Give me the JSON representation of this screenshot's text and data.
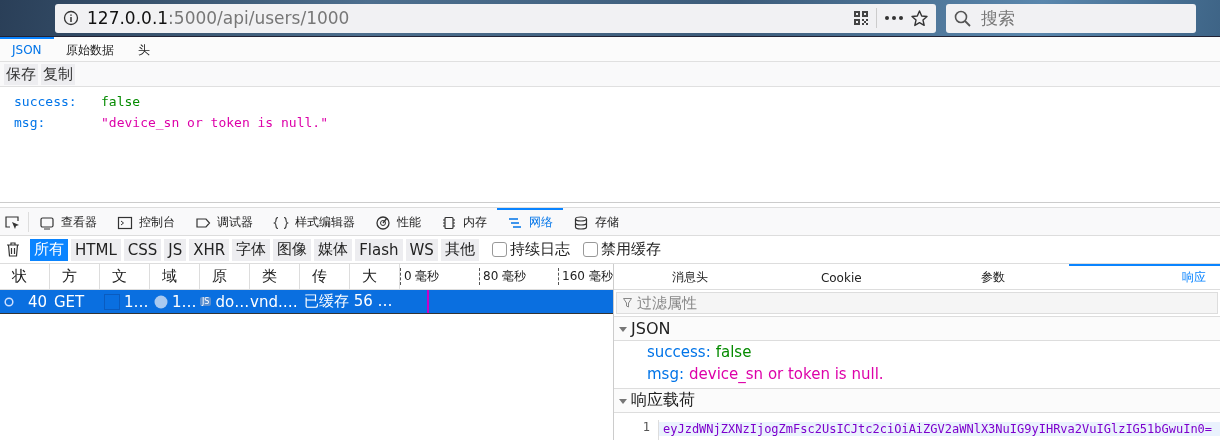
{
  "browser": {
    "url_host": "127.0.0.1",
    "url_path": ":5000/api/users/1000",
    "search_placeholder": "搜索"
  },
  "viewer_tabs": [
    {
      "label": "JSON",
      "selected": true
    },
    {
      "label": "原始数据",
      "selected": false
    },
    {
      "label": "头",
      "selected": false
    }
  ],
  "viewer_buttons": [
    "保存",
    "复制"
  ],
  "json_rows": [
    {
      "key": "success:",
      "value": "false",
      "kind": "boolean"
    },
    {
      "key": "msg:",
      "value": "\"device_sn or token is null.\"",
      "kind": "string"
    }
  ],
  "devtools_tabs": [
    {
      "label": "查看器",
      "selected": false
    },
    {
      "label": "控制台",
      "selected": false
    },
    {
      "label": "调试器",
      "selected": false
    },
    {
      "label": "样式编辑器",
      "selected": false
    },
    {
      "label": "性能",
      "selected": false
    },
    {
      "label": "内存",
      "selected": false
    },
    {
      "label": "网络",
      "selected": true
    },
    {
      "label": "存储",
      "selected": false
    }
  ],
  "filters": [
    {
      "label": "所有",
      "selected": true
    },
    {
      "label": "HTML",
      "selected": false
    },
    {
      "label": "CSS",
      "selected": false
    },
    {
      "label": "JS",
      "selected": false
    },
    {
      "label": "XHR",
      "selected": false
    },
    {
      "label": "字体",
      "selected": false
    },
    {
      "label": "图像",
      "selected": false
    },
    {
      "label": "媒体",
      "selected": false
    },
    {
      "label": "Flash",
      "selected": false
    },
    {
      "label": "WS",
      "selected": false
    },
    {
      "label": "其他",
      "selected": false
    }
  ],
  "checkboxes": [
    {
      "label": "持续日志",
      "checked": false
    },
    {
      "label": "禁用缓存",
      "checked": false
    }
  ],
  "columns": [
    "状",
    "方",
    "文",
    "域",
    "原",
    "类",
    "传",
    "大"
  ],
  "timeline_ticks": [
    "0 毫秒",
    "80 毫秒",
    "160 毫秒"
  ],
  "requests": [
    {
      "status": "40",
      "method": "GET",
      "file": "1…",
      "domain": "1…",
      "cause_badge": "JS",
      "cause": "do…",
      "type": "vnd.…",
      "transferred": "已缓存 56 …",
      "selected": true
    }
  ],
  "detail_tabs": [
    {
      "label": "消息头",
      "selected": false
    },
    {
      "label": "Cookie",
      "selected": false
    },
    {
      "label": "参数",
      "selected": false
    },
    {
      "label": "响应",
      "selected": true
    }
  ],
  "filter_placeholder": "过滤属性",
  "json_section": {
    "title": "JSON",
    "expanded": true,
    "rows": [
      {
        "key": "success:",
        "value": "false",
        "kind": "boolean"
      },
      {
        "key": "msg:",
        "value": "device_sn or token is null.",
        "kind": "string"
      }
    ]
  },
  "payload_section": {
    "title": "响应载荷",
    "expanded": true,
    "lines": [
      {
        "number": "1",
        "code": "eyJzdWNjZXNzIjogZmFsc2UsICJtc2ciOiAiZGV2aWNlX3NuIG9yIHRva2VuIGlzIG51bGwuIn0="
      }
    ]
  }
}
